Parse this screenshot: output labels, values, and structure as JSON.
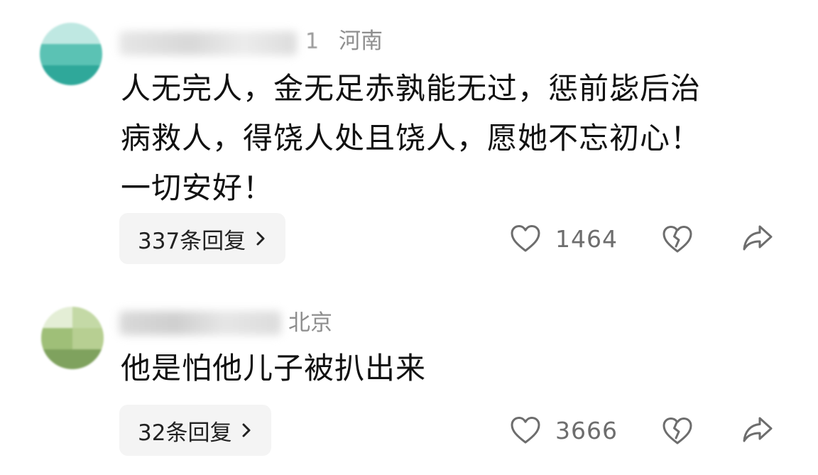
{
  "comments": [
    {
      "username_tail": "1",
      "location": "河南",
      "content": "人无完人，金无足赤孰能无过，惩前毖后治\n病救人，得饶人处且饶人，愿她不忘初心！\n一切安好！",
      "reply_label": "337条回复",
      "like_count": "1464",
      "avatar_colors": [
        "#2fa89a",
        "#5bc2b4",
        "#8fd6cc",
        "#bfe8e2"
      ]
    },
    {
      "location": "北京",
      "content": "他是怕他儿子被扒出来",
      "reply_label": "32条回复",
      "like_count": "3666",
      "avatar_colors": [
        "#9fbf78",
        "#c4d9a6",
        "#7fa25e",
        "#e4eed6"
      ]
    }
  ],
  "icons": {
    "like": "heart-outline-icon",
    "dislike": "broken-heart-icon",
    "share": "share-arrow-icon",
    "reply_chevron": "chevron-right-icon"
  }
}
